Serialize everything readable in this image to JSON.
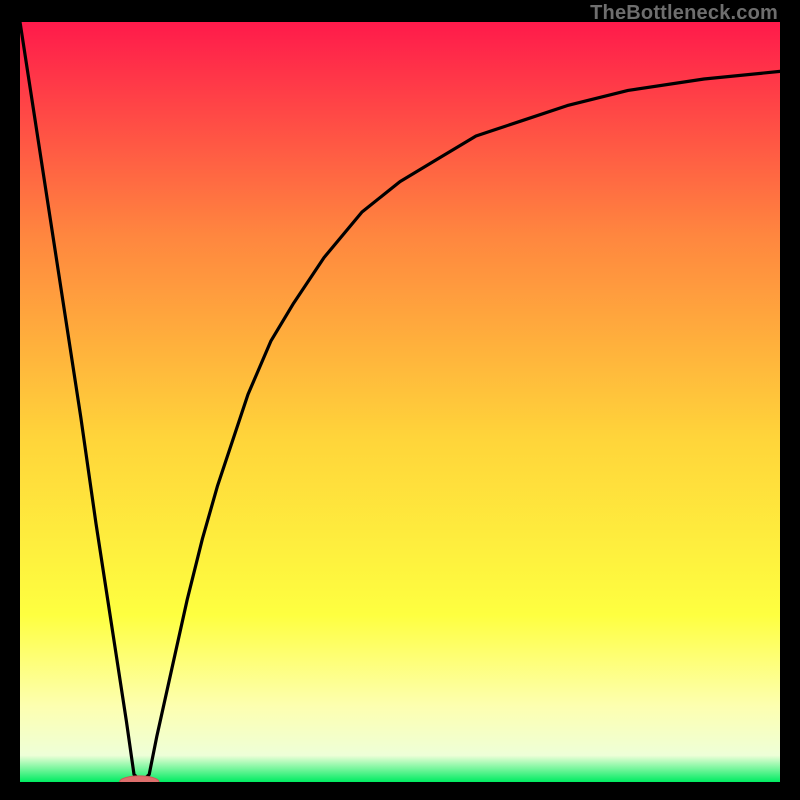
{
  "watermark": "TheBottleneck.com",
  "colors": {
    "black": "#000000",
    "curve": "#000000",
    "marker_fill": "#de6e6c",
    "marker_stroke": "#c85a58",
    "gradient_top": "#ff1a4b",
    "gradient_upper_mid": "#ff863f",
    "gradient_mid": "#ffd53a",
    "gradient_lower_mid": "#feff40",
    "gradient_pale": "#fdffb0",
    "gradient_bottom": "#00ec62"
  },
  "chart_data": {
    "type": "line",
    "title": "",
    "xlabel": "",
    "ylabel": "",
    "xlim": [
      0,
      100
    ],
    "ylim": [
      0,
      100
    ],
    "grid": false,
    "legend": false,
    "series": [
      {
        "name": "bottleneck-curve",
        "x": [
          0,
          2,
          4,
          6,
          8,
          10,
          12,
          14,
          15,
          16,
          17,
          18,
          20,
          22,
          24,
          26,
          28,
          30,
          33,
          36,
          40,
          45,
          50,
          55,
          60,
          66,
          72,
          80,
          90,
          100
        ],
        "y": [
          100,
          87,
          74,
          61,
          48,
          34,
          21,
          8,
          1,
          0,
          1,
          6,
          15,
          24,
          32,
          39,
          45,
          51,
          58,
          63,
          69,
          75,
          79,
          82,
          85,
          87,
          89,
          91,
          92.5,
          93.5
        ]
      }
    ],
    "marker": {
      "x": 15.7,
      "y": 0,
      "rx": 2.6,
      "ry": 0.8
    },
    "background": {
      "type": "vertical-gradient",
      "stops": [
        {
          "offset": 0.0,
          "color": "#ff1a4b"
        },
        {
          "offset": 0.28,
          "color": "#ff863f"
        },
        {
          "offset": 0.55,
          "color": "#ffd53a"
        },
        {
          "offset": 0.78,
          "color": "#feff40"
        },
        {
          "offset": 0.9,
          "color": "#fdffb0"
        },
        {
          "offset": 0.965,
          "color": "#eeffd8"
        },
        {
          "offset": 1.0,
          "color": "#00ec62"
        }
      ]
    }
  }
}
